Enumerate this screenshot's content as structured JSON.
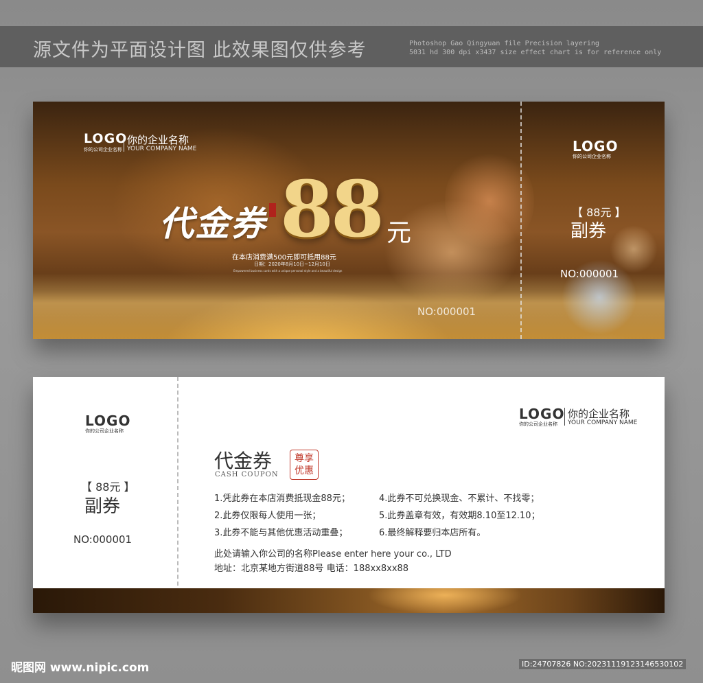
{
  "banner": {
    "cn": "源文件为平面设计图  此效果图仅供参考",
    "en_line1": "Photoshop Gao Qingyuan file Precision layering",
    "en_line2": "5031 hd 300 dpi x3437 size effect chart is for reference only"
  },
  "front": {
    "logo": "LOGO",
    "logo_sub": "你的公司企业名称",
    "company_cn": "你的企业名称",
    "company_en": "YOUR COMPANY NAME",
    "title": "代金券",
    "amount": "88",
    "unit": "元",
    "description": "在本店消费满500元即可抵用88元",
    "date": "日期：2020年8月10日~12月10日",
    "fine_print": "Empowered business cards with a unique personal style and a beautiful design",
    "number": "NO:000001",
    "stub": {
      "logo": "LOGO",
      "logo_sub": "你的公司企业名称",
      "price": "【 88元 】",
      "label": "副券",
      "number": "NO:000001"
    }
  },
  "back": {
    "stub": {
      "logo": "LOGO",
      "logo_sub": "你的公司企业名称",
      "price": "【 88元 】",
      "label": "副券",
      "number": "NO:000001"
    },
    "logo": "LOGO",
    "logo_sub": "你的公司企业名称",
    "company_cn": "你的企业名称",
    "company_en": "YOUR COMPANY NAME",
    "heading": "代金券",
    "heading_en": "CASH COUPON",
    "seal_line1": "尊享",
    "seal_line2": "优惠",
    "rules": [
      {
        "left": "1.凭此券在本店消费抵现金88元；",
        "right": "4.此券不可兑换现金、不累计、不找零；"
      },
      {
        "left": "2.此券仅限每人使用一张；",
        "right": "5.此券盖章有效，有效期8.10至12.10；"
      },
      {
        "left": "3.此券不能与其他优惠活动重叠；",
        "right": "6.最终解释要归本店所有。"
      }
    ],
    "contact_line1": "此处请输入你公司的名称Please enter here your co., LTD",
    "contact_line2": "地址：北京某地方街道88号  电话：188xx8xx88"
  },
  "footer": {
    "left": "昵图网 www.nipic.com",
    "right": "ID:24707826 NO:20231119123146530102"
  }
}
